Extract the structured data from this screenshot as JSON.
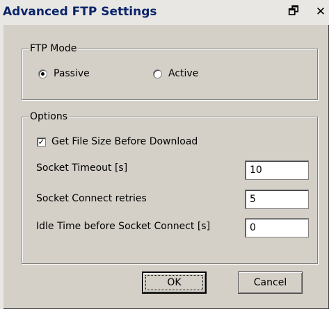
{
  "window": {
    "title": "Advanced FTP Settings",
    "restore_icon": "🗗",
    "close_icon": "✕"
  },
  "ftp_mode": {
    "legend": "FTP Mode",
    "options": [
      {
        "label": "Passive",
        "selected": true
      },
      {
        "label": "Active",
        "selected": false
      }
    ]
  },
  "options": {
    "legend": "Options",
    "get_file_size": {
      "label": "Get File Size Before Download",
      "checked": true,
      "check_mark": "✓"
    },
    "socket_timeout": {
      "label": "Socket Timeout [s]",
      "value": "10"
    },
    "socket_retries": {
      "label": "Socket Connect retries",
      "value": "5"
    },
    "idle_time": {
      "label": "Idle Time before Socket Connect [s]",
      "value": "0"
    }
  },
  "buttons": {
    "ok": "OK",
    "cancel": "Cancel"
  },
  "colors": {
    "dialog_bg": "#d4d0c8",
    "title_text": "#0a246a",
    "titlebar_bg": "#e9e7e3"
  }
}
